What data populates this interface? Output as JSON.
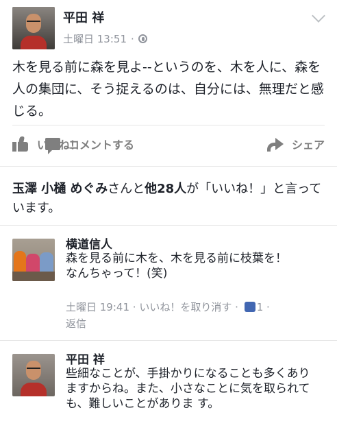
{
  "post": {
    "author": "平田 祥",
    "timestamp": "土曜日 13:51",
    "separator": "·",
    "text": "木を見る前に森を見よ--というのを、木を人に、森を人の集団に、そう捉えるのは、自分には、無理だと感じる。"
  },
  "actions": {
    "like_label": "いいね！",
    "comment_label": "コメントする",
    "share_label": "シェア"
  },
  "likes_summary": {
    "names": "玉澤 小樋 めぐみ",
    "joiner": "さんと",
    "others": "他28人",
    "suffix": "が「いいね！」と言っています。"
  },
  "comments": [
    {
      "author": "横道信人",
      "text_line1": "森を見る前に木を、木を見る前に枝葉を！",
      "text_line2": "なんちゃって！(笑)",
      "timestamp": "土曜日 19:41",
      "sep": "·",
      "unlike_label": "いいね！を取り消す",
      "like_count": "1",
      "reply_label": "返信"
    },
    {
      "author": "平田 祥",
      "text": "些細なことが、手掛かりになることも多くありますからね。また、小さなことに気を取られても、難しいことがありま す。"
    }
  ],
  "colors": {
    "text": "#1d2129",
    "meta": "#90949c",
    "action": "#7f7f7f",
    "accent": "#4267b2"
  }
}
